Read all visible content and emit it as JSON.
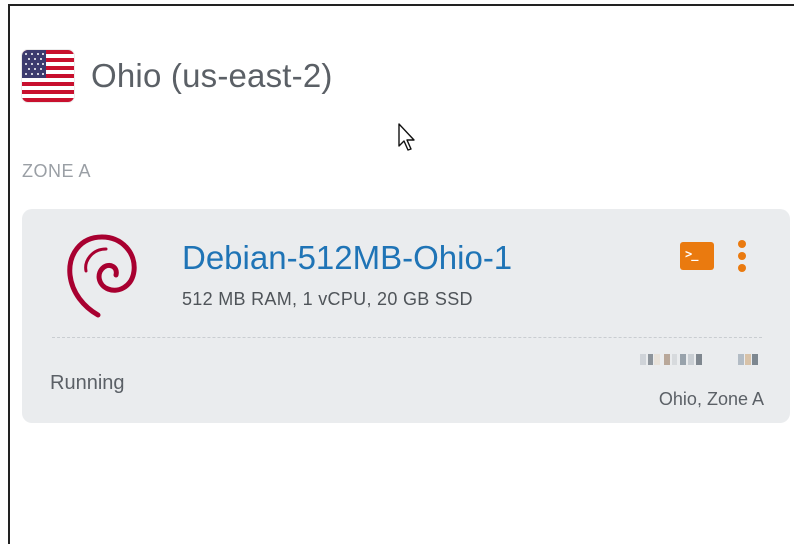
{
  "region": {
    "flag_icon": "us-flag-icon",
    "title": "Ohio (us-east-2)"
  },
  "zone": {
    "label": "ZONE A"
  },
  "instance": {
    "os_icon": "debian-logo-icon",
    "name": "Debian-512MB-Ohio-1",
    "specs": "512 MB RAM, 1 vCPU, 20 GB SSD",
    "status": "Running",
    "location": "Ohio, Zone A",
    "connect_icon": "terminal-icon",
    "menu_icon": "kebab-menu-icon",
    "ip_address_obscured": true
  },
  "colors": {
    "accent": "#ea7a0f",
    "link": "#1f74b6",
    "card_bg": "#eaecee",
    "debian_red": "#a80030"
  }
}
